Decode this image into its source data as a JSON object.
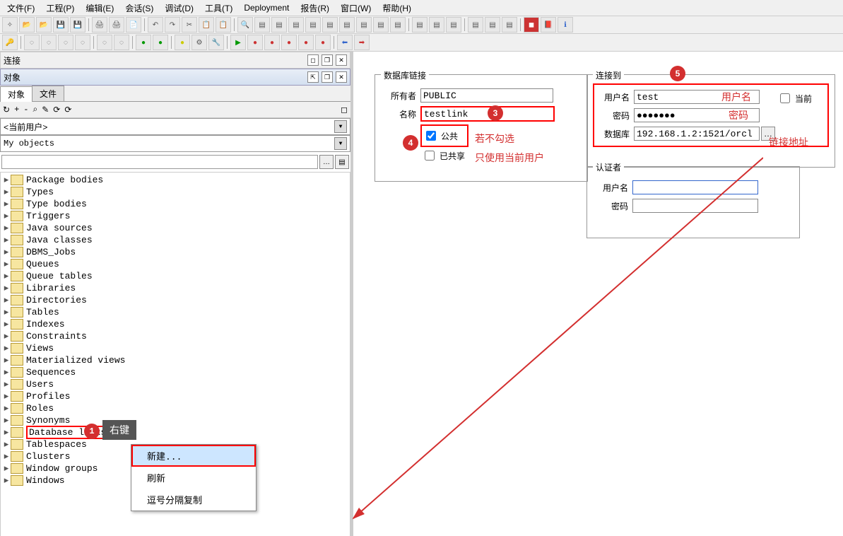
{
  "menu": [
    "文件(F)",
    "工程(P)",
    "编辑(E)",
    "会话(S)",
    "调试(D)",
    "工具(T)",
    "Deployment",
    "报告(R)",
    "窗口(W)",
    "帮助(H)"
  ],
  "panels": {
    "connect": "连接",
    "objects": "对象"
  },
  "tabs": {
    "objects": "对象",
    "files": "文件"
  },
  "mini_icons": [
    "↻",
    "+",
    "-",
    "⌕",
    "✎",
    "⟳",
    "⟳"
  ],
  "current_user": "<当前用户>",
  "my_objects": "My objects",
  "tree": [
    "Package bodies",
    "Types",
    "Type bodies",
    "Triggers",
    "Java sources",
    "Java classes",
    "DBMS_Jobs",
    "Queues",
    "Queue tables",
    "Libraries",
    "Directories",
    "Tables",
    "Indexes",
    "Constraints",
    "Views",
    "Materialized views",
    "Sequences",
    "Users",
    "Profiles",
    "Roles",
    "Synonyms",
    "Database links",
    "Tablespaces",
    "Clusters",
    "Window groups",
    "Windows"
  ],
  "sel_index": 21,
  "ctx": [
    "新建...",
    "刷新",
    "逗号分隔复制"
  ],
  "tooltip": "右键",
  "form": {
    "dblink": {
      "legend": "数据库链接",
      "owner_lbl": "所有者",
      "owner": "PUBLIC",
      "name_lbl": "名称",
      "name": "testlink",
      "public": "公共",
      "shared": "已共享"
    },
    "connect": {
      "legend": "连接到",
      "user_lbl": "用户名",
      "user": "test",
      "current": "当前",
      "pwd_lbl": "密码",
      "pwd": "●●●●●●●",
      "db_lbl": "数据库",
      "db": "192.168.1.2:1521/orcl"
    },
    "auth": {
      "legend": "认证者",
      "user_lbl": "用户名",
      "pwd_lbl": "密码"
    }
  },
  "annot": {
    "note4a": "若不勾选",
    "note4b": "只使用当前用户",
    "user": "用户名",
    "pwd": "密码",
    "db": "链接地址"
  }
}
